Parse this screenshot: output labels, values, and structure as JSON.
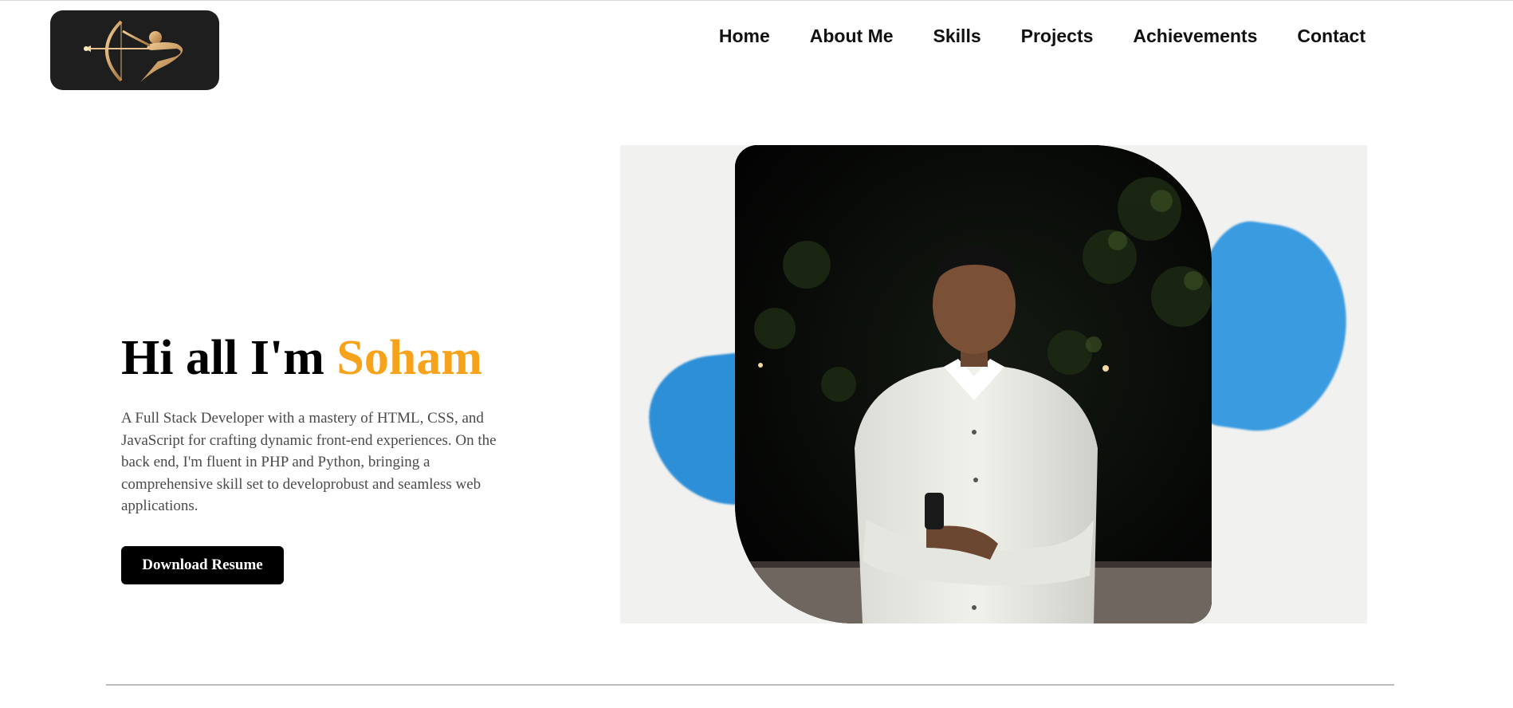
{
  "header": {
    "logo_icon": "archer-icon",
    "nav": [
      {
        "label": "Home"
      },
      {
        "label": "About Me"
      },
      {
        "label": "Skills"
      },
      {
        "label": "Projects"
      },
      {
        "label": "Achievements"
      },
      {
        "label": "Contact"
      }
    ]
  },
  "hero": {
    "title_prefix": "Hi all I'm ",
    "title_name": "Soham",
    "description": "A Full Stack Developer with a mastery of HTML, CSS, and JavaScript for crafting dynamic front-end experiences. On the back end, I'm fluent in PHP and Python, bringing a comprehensive skill set to developrobust and seamless web applications.",
    "button_label": "Download Resume"
  },
  "colors": {
    "accent": "#f7a21b",
    "paint_blue": "#2d8fd8",
    "button_bg": "#000000",
    "logo_bg": "#1e1e1e"
  }
}
